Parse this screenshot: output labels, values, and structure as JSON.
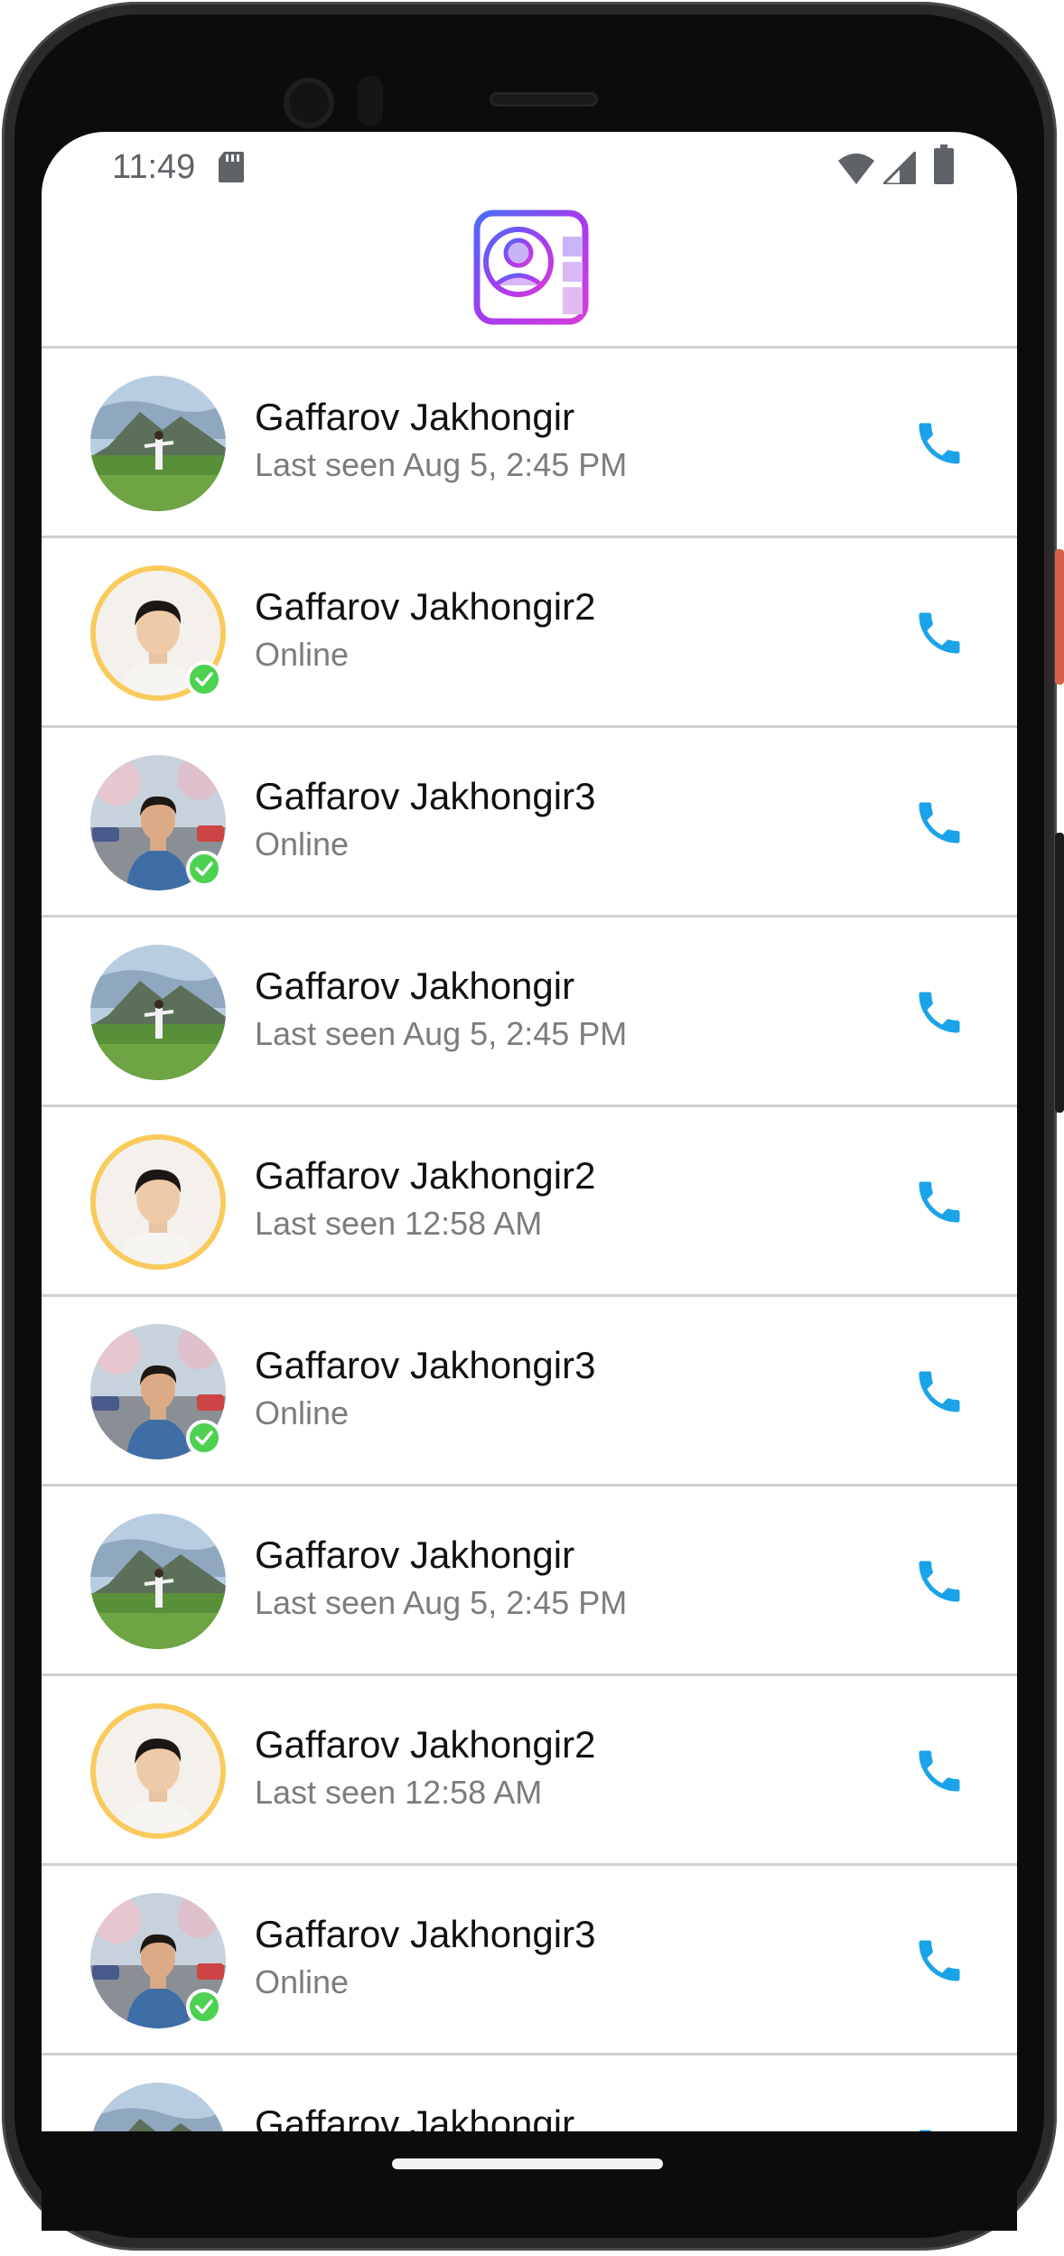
{
  "status_bar": {
    "time": "11:49"
  },
  "colors": {
    "call_icon": "#1aa3e8",
    "online_badge": "#4cd151",
    "avatar_ring": "#f9cb5c",
    "status_text": "#7c7c7c",
    "logo_gradient": [
      "#4a6cf7",
      "#a33cf0",
      "#d63cd9"
    ]
  },
  "icons": {
    "sd_card": "sd-card-icon",
    "wifi": "wifi-icon",
    "signal": "signal-icon",
    "battery": "battery-icon",
    "logo": "contacts-book-icon",
    "call": "phone-icon",
    "online": "check-circle-icon"
  },
  "contacts": [
    {
      "name": "Gaffarov Jakhongir",
      "status": "Last seen Aug 5, 2:45 PM",
      "avatar": "landscape",
      "ring": false,
      "online": false
    },
    {
      "name": "Gaffarov Jakhongir2",
      "status": "Online",
      "avatar": "portrait",
      "ring": true,
      "online": true
    },
    {
      "name": "Gaffarov Jakhongir3",
      "status": "Online",
      "avatar": "street",
      "ring": false,
      "online": true
    },
    {
      "name": "Gaffarov Jakhongir",
      "status": "Last seen Aug 5, 2:45 PM",
      "avatar": "landscape",
      "ring": false,
      "online": false
    },
    {
      "name": "Gaffarov Jakhongir2",
      "status": "Last seen 12:58 AM",
      "avatar": "portrait",
      "ring": true,
      "online": false
    },
    {
      "name": "Gaffarov Jakhongir3",
      "status": "Online",
      "avatar": "street",
      "ring": false,
      "online": true
    },
    {
      "name": "Gaffarov Jakhongir",
      "status": "Last seen Aug 5, 2:45 PM",
      "avatar": "landscape",
      "ring": false,
      "online": false
    },
    {
      "name": "Gaffarov Jakhongir2",
      "status": "Last seen 12:58 AM",
      "avatar": "portrait",
      "ring": true,
      "online": false
    },
    {
      "name": "Gaffarov Jakhongir3",
      "status": "Online",
      "avatar": "street",
      "ring": false,
      "online": true
    },
    {
      "name": "Gaffarov Jakhongir",
      "status": "",
      "avatar": "landscape",
      "ring": false,
      "online": false
    }
  ]
}
